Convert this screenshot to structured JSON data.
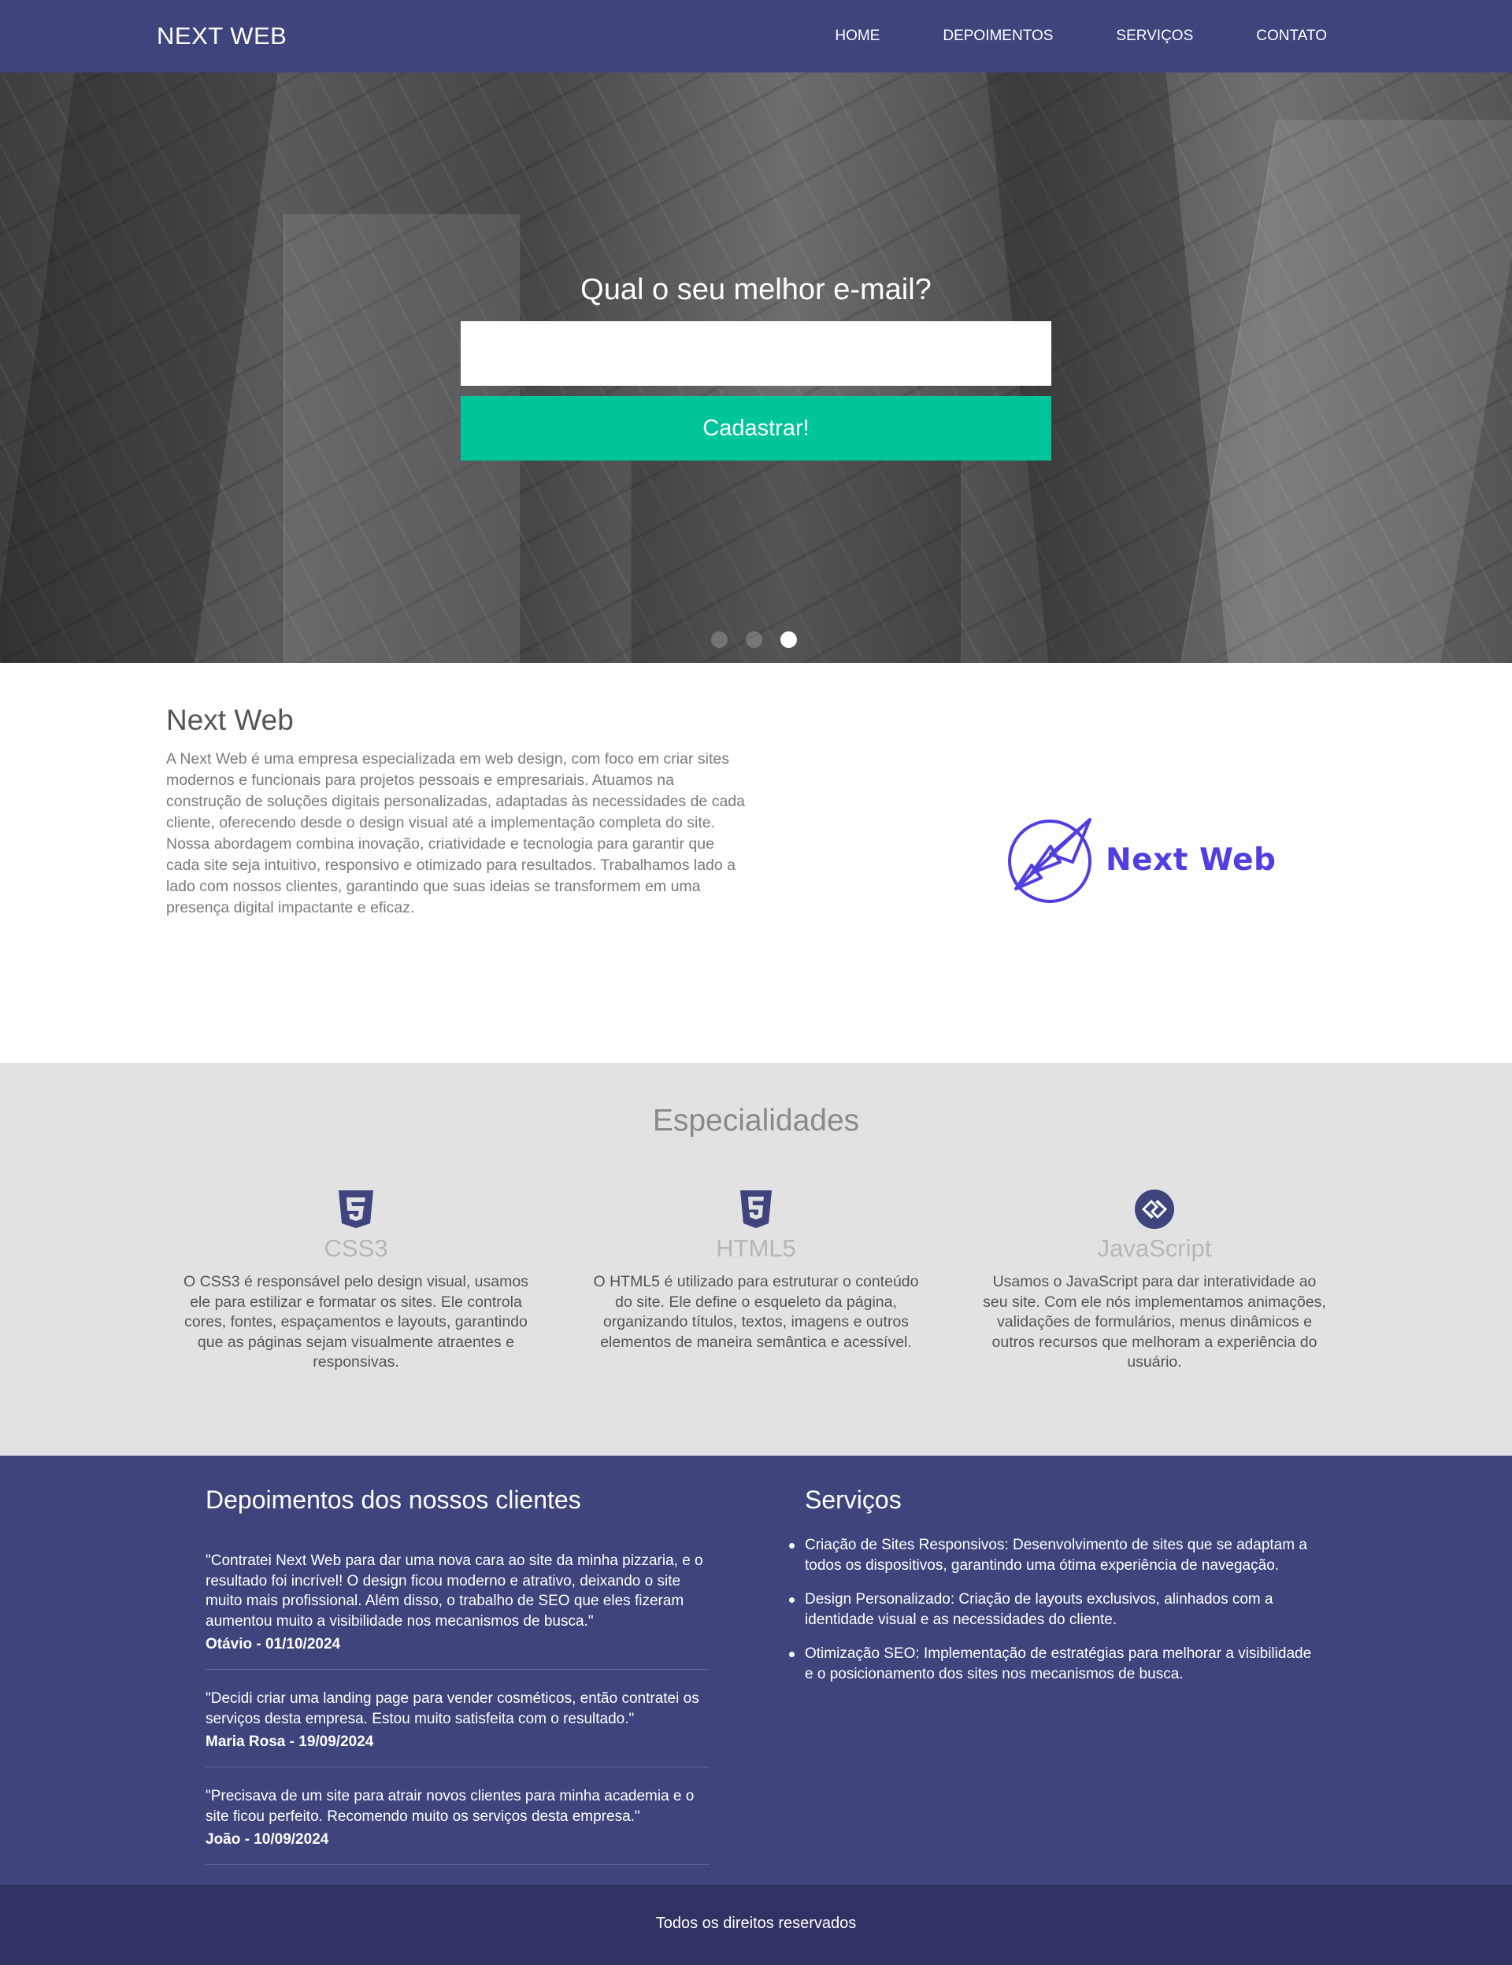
{
  "navbar": {
    "brand": "NEXT WEB",
    "links": [
      "HOME",
      "DEPOIMENTOS",
      "SERVIÇOS",
      "CONTATO"
    ]
  },
  "hero": {
    "title": "Qual o seu melhor e-mail?",
    "email_value": "",
    "submit_label": "Cadastrar!",
    "slides_count": 3,
    "active_slide": 3
  },
  "about": {
    "title": "Next Web",
    "text": "A Next Web é uma empresa especializada em web design, com foco em criar sites modernos e funcionais para projetos pessoais e empresariais. Atuamos na construção de soluções digitais personalizadas, adaptadas às necessidades de cada cliente, oferecendo desde o design visual até a implementação completa do site. Nossa abordagem combina inovação, criatividade e tecnologia para garantir que cada site seja intuitivo, responsivo e otimizado para resultados. Trabalhamos lado a lado com nossos clientes, garantindo que suas ideias se transformem em uma presença digital impactante e eficaz.",
    "logo_text": "Next Web",
    "logo_icon": "paper-arrows-logo-icon"
  },
  "specialties": {
    "title": "Especialidades",
    "items": [
      {
        "icon": "css3-icon",
        "name": "CSS3",
        "text": "O CSS3 é responsável pelo design visual, usamos ele para estilizar e formatar os sites. Ele controla cores, fontes, espaçamentos e layouts, garantindo que as páginas sejam visualmente atraentes e responsivas."
      },
      {
        "icon": "html5-icon",
        "name": "HTML5",
        "text": "O HTML5 é utilizado para estruturar o conteúdo do site. Ele define o esqueleto da página, organizando títulos, textos, imagens e outros elementos de maneira semântica e acessível."
      },
      {
        "icon": "javascript-icon",
        "name": "JavaScript",
        "text": "Usamos o JavaScript para dar interatividade ao seu site. Com ele nós implementamos animações, validações de formulários, menus dinâmicos e outros recursos que melhoram a experiência do usuário."
      }
    ]
  },
  "testimonials": {
    "title": "Depoimentos dos nossos clientes",
    "items": [
      {
        "quote": "\"Contratei Next Web para dar uma nova cara ao site da minha pizzaria, e o resultado foi incrível! O design ficou moderno e atrativo, deixando o site muito mais profissional. Além disso, o trabalho de SEO que eles fizeram aumentou muito a visibilidade nos mecanismos de busca.\"",
        "author": "Otávio - 01/10/2024"
      },
      {
        "quote": "\"Decidi criar uma landing page para vender cosméticos, então contratei os serviços desta empresa. Estou muito satisfeita com o resultado.\"",
        "author": "Maria Rosa - 19/09/2024"
      },
      {
        "quote": "\"Precisava de um site para atrair novos clientes para minha academia e o site ficou perfeito. Recomendo muito os serviços desta empresa.\"",
        "author": "João - 10/09/2024"
      }
    ]
  },
  "services": {
    "title": "Serviços",
    "items": [
      "Criação de Sites Responsivos: Desenvolvimento de sites que se adaptam a todos os dispositivos, garantindo uma ótima experiência de navegação.",
      "Design Personalizado: Criação de layouts exclusivos, alinhados com a identidade visual e as necessidades do cliente.",
      "Otimização SEO: Implementação de estratégias para melhorar a visibilidade e o posicionamento dos sites nos mecanismos de busca."
    ]
  },
  "footer": {
    "text": "Todos os direitos reservados"
  },
  "colors": {
    "primary": "#3f447d",
    "footer": "#2f3262",
    "accent": "#00c49a",
    "logo": "#4f3fe0",
    "specialties_bg": "#e2e2e2"
  }
}
